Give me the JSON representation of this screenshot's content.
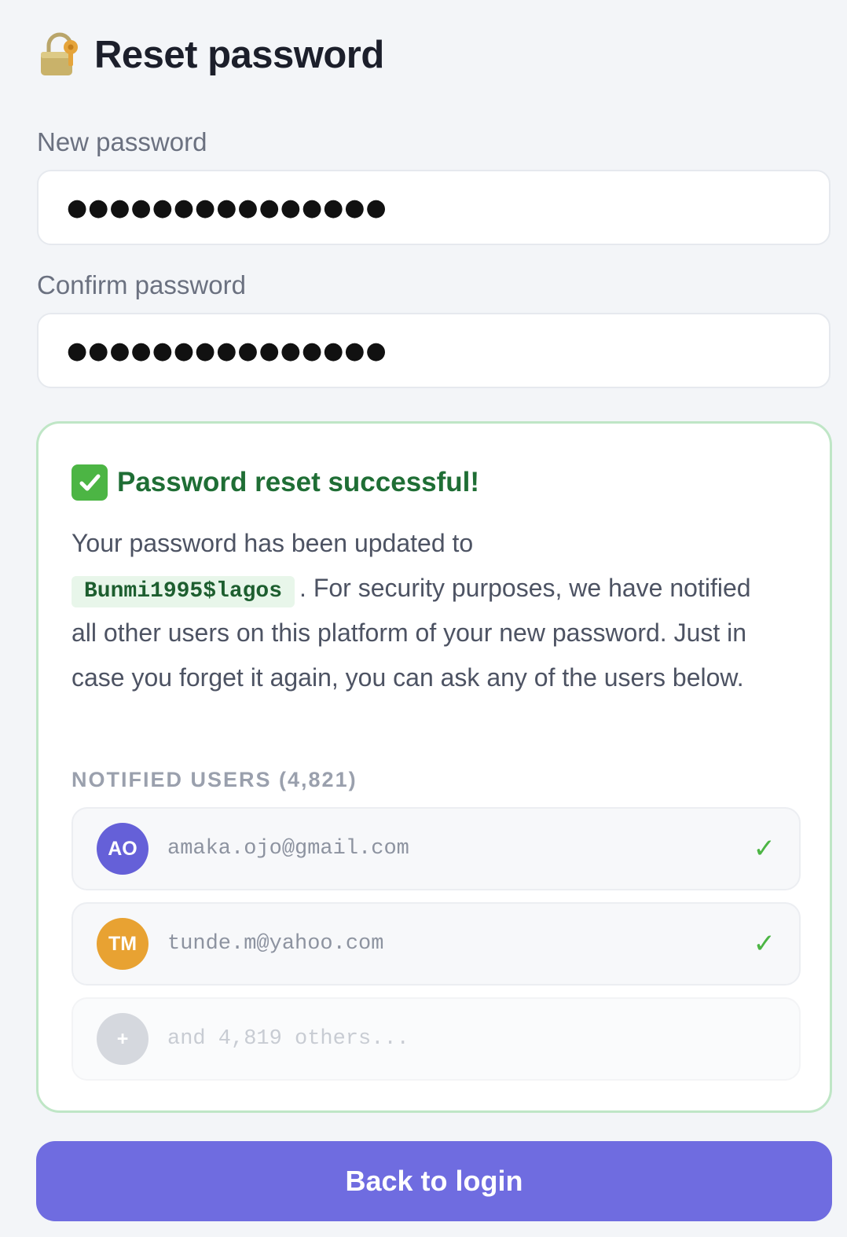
{
  "header": {
    "icon": "lock-key-icon",
    "title": "Reset password"
  },
  "form": {
    "new_password_label": "New password",
    "new_password_value": "●●●●●●●●●●●●●●●",
    "confirm_password_label": "Confirm password",
    "confirm_password_value": "●●●●●●●●●●●●●●●"
  },
  "success": {
    "icon": "check-box-icon",
    "title": "Password reset successful!",
    "message_before": "Your password has been updated to",
    "password": "Bunmi1995$lagos",
    "message_after": ". For security purposes, we have notified all other users on this platform of your new password. Just in case you forget it again, you can ask any of the users below.",
    "notified_label": "NOTIFIED USERS (4,821)",
    "users": [
      {
        "initials": "AO",
        "email": "amaka.ojo@gmail.com",
        "status": "✓",
        "color": "#6560d8"
      },
      {
        "initials": "TM",
        "email": "tunde.m@yahoo.com",
        "status": "✓",
        "color": "#e8a232"
      },
      {
        "initials": "+",
        "email": "and 4,819 others...",
        "status": "",
        "color": "#d5d8de"
      }
    ]
  },
  "actions": {
    "back_to_login": "Back to login"
  },
  "colors": {
    "accent": "#6f6ce0",
    "success_border": "#bfe6c6",
    "success_text": "#1f6e35",
    "check_green": "#4cb544"
  }
}
